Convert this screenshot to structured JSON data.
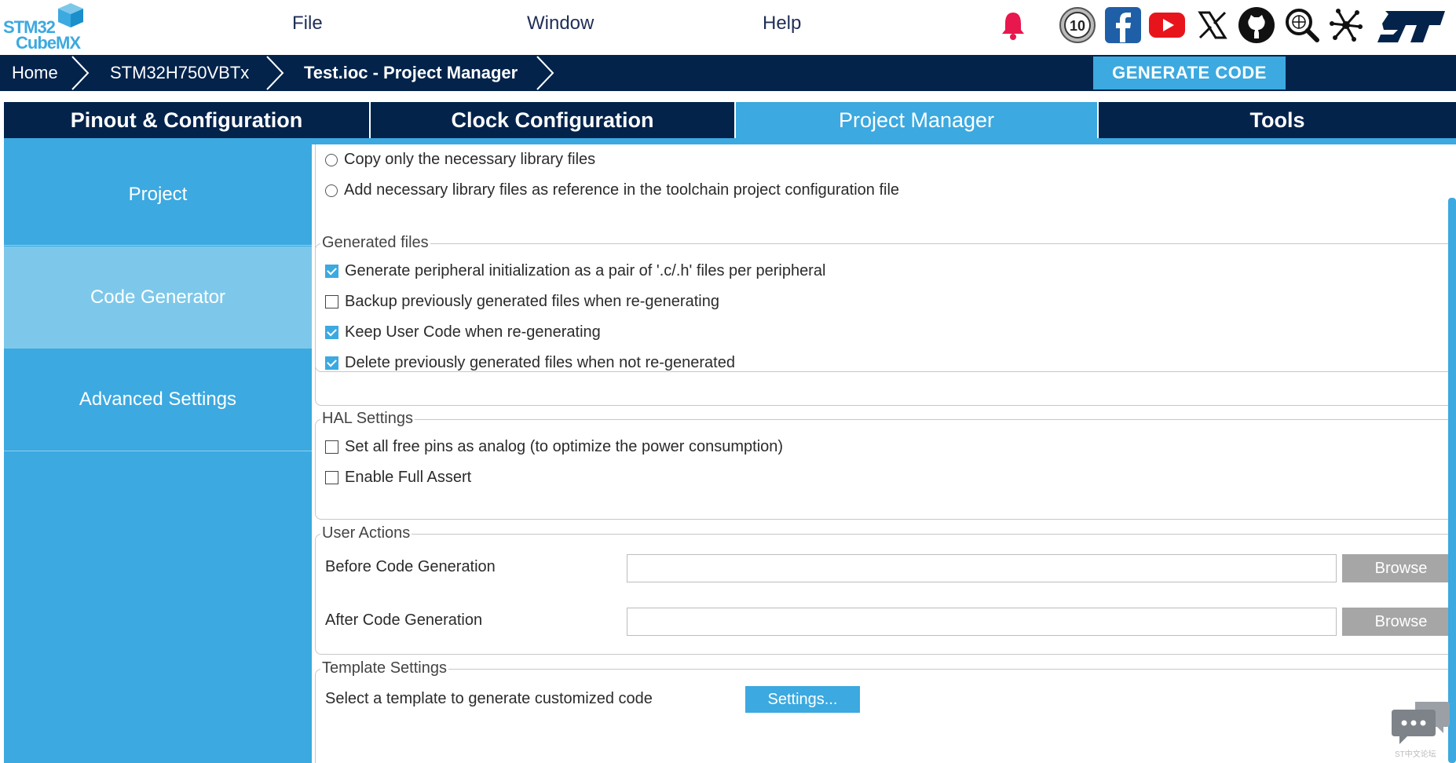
{
  "app": {
    "logo_line1": "STM32",
    "logo_line2": "CubeMX"
  },
  "menu": [
    "File",
    "Window",
    "Help"
  ],
  "social_icons": [
    "bell-icon",
    "anniversary-10-icon",
    "facebook-icon",
    "youtube-icon",
    "x-icon",
    "github-icon",
    "search-globe-icon",
    "network-icon",
    "st-logo-icon"
  ],
  "breadcrumb": [
    "Home",
    "STM32H750VBTx",
    "Test.ioc - Project Manager"
  ],
  "generate_button": "GENERATE CODE",
  "tabs": [
    "Pinout & Configuration",
    "Clock Configuration",
    "Project Manager",
    "Tools"
  ],
  "active_tab": "Project Manager",
  "sidebar": [
    "Project",
    "Code Generator",
    "Advanced Settings"
  ],
  "active_sidebar": "Code Generator",
  "library_options": [
    "Copy only the necessary library files",
    "Add necessary library files as reference in the toolchain project configuration file"
  ],
  "generated_files": {
    "legend": "Generated files",
    "options": [
      {
        "label": "Generate peripheral initialization as a pair of '.c/.h' files per peripheral",
        "checked": true
      },
      {
        "label": "Backup previously generated files when re-generating",
        "checked": false
      },
      {
        "label": "Keep User Code when re-generating",
        "checked": true
      },
      {
        "label": "Delete previously generated files when not re-generated",
        "checked": true
      }
    ]
  },
  "hal_settings": {
    "legend": "HAL Settings",
    "options": [
      {
        "label": "Set all free pins as analog (to optimize the power consumption)",
        "checked": false
      },
      {
        "label": "Enable Full Assert",
        "checked": false
      }
    ]
  },
  "user_actions": {
    "legend": "User Actions",
    "before_label": "Before Code Generation",
    "before_value": "",
    "after_label": "After Code Generation",
    "after_value": "",
    "browse": "Browse"
  },
  "template_settings": {
    "legend": "Template Settings",
    "text": "Select a template to generate customized code",
    "button": "Settings..."
  },
  "chat_caption": "ST中文论坛",
  "colors": {
    "navy": "#03234b",
    "accent": "#3ca9e0",
    "sidebar_active": "#7dc8ea",
    "bell": "#e8174d"
  }
}
